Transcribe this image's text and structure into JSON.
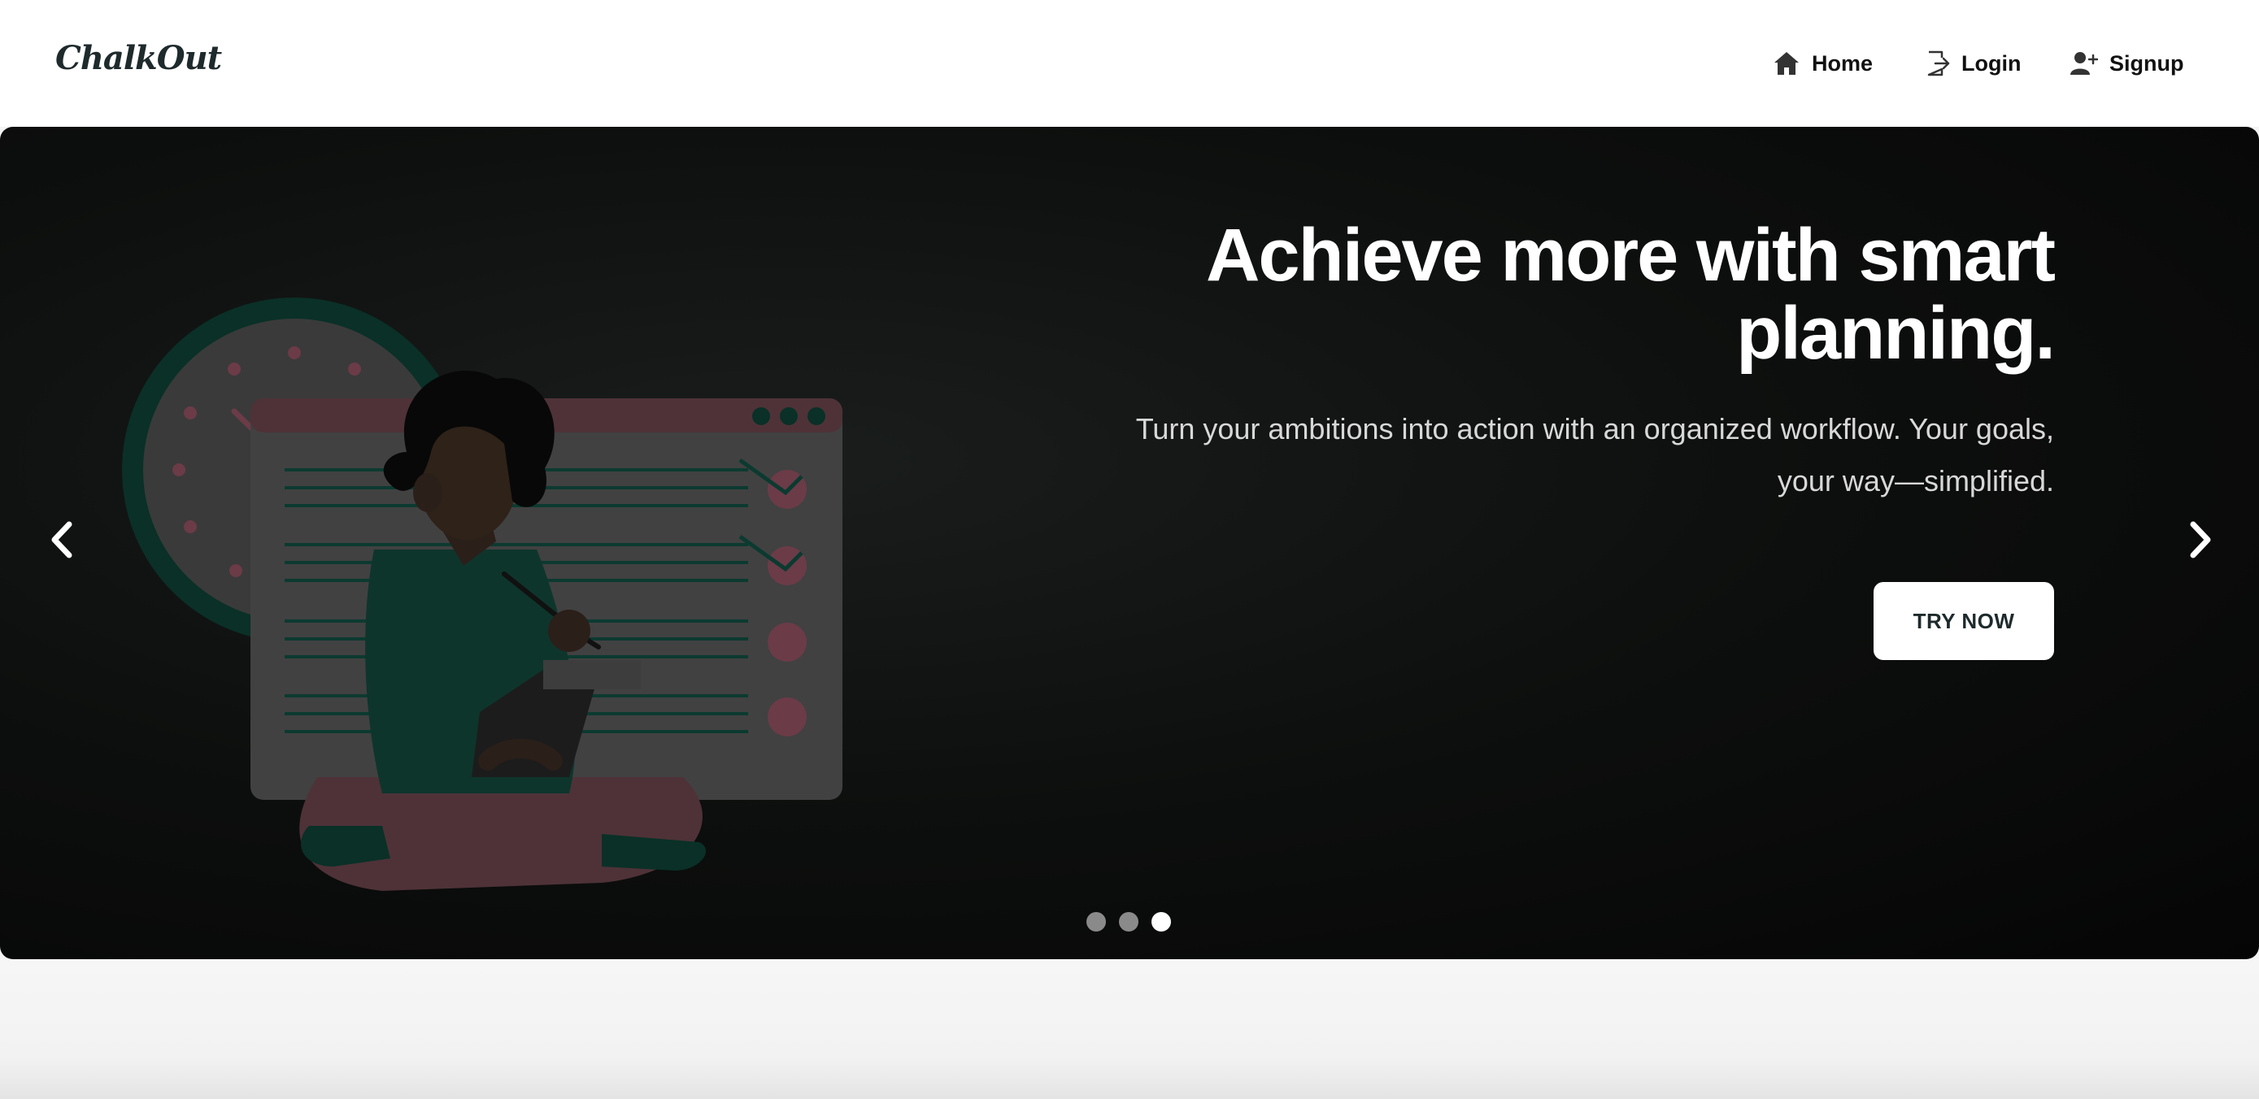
{
  "navbar": {
    "brand": "ChalkOut",
    "items": [
      {
        "label": "Home",
        "icon": "home-icon"
      },
      {
        "label": "Login",
        "icon": "login-icon"
      },
      {
        "label": "Signup",
        "icon": "user-plus-icon"
      }
    ]
  },
  "hero": {
    "title": "Achieve more with smart planning.",
    "subtitle_line1": "Turn your ambitions into action with an organized workflow. Your goals,",
    "subtitle_line2": "your way—simplified.",
    "cta_label": "TRY NOW",
    "slides_count": 3,
    "active_slide": 3,
    "prev_icon": "chevron-left-icon",
    "next_icon": "chevron-right-icon"
  },
  "colors": {
    "brand_text": "#1e2a2c",
    "hero_bg": "#0d0f0e",
    "accent_green": "#0c3a30",
    "accent_pink": "#6b3b48",
    "button_bg": "#ffffff"
  }
}
